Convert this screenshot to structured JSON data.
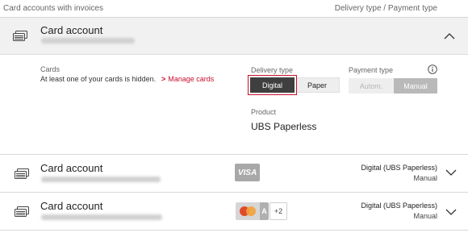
{
  "header": {
    "left": "Card accounts with invoices",
    "right": "Delivery type / Payment type"
  },
  "expanded_account": {
    "title": "Card account",
    "icon": "card-stack-icon",
    "chevron": "chevron-up-icon"
  },
  "details": {
    "cards_label": "Cards",
    "cards_text": "At least one of your cards is hidden.",
    "manage_link": "Manage cards",
    "delivery_label": "Delivery type",
    "delivery_options": [
      "Digital",
      "Paper"
    ],
    "delivery_selected": "Digital",
    "payment_label": "Payment type",
    "payment_options": [
      "Autom.",
      "Manual"
    ],
    "payment_selected": "Manual",
    "info_icon": "info-circle-icon",
    "product_label": "Product",
    "product_value": "UBS Paperless"
  },
  "accounts": [
    {
      "title": "Card account",
      "card_brands": [
        "VISA"
      ],
      "delivery": "Digital (UBS Paperless)",
      "payment": "Manual"
    },
    {
      "title": "Card account",
      "card_brands": [
        "Mastercard",
        "A"
      ],
      "more_count": "+2",
      "delivery": "Digital (UBS Paperless)",
      "payment": "Manual"
    }
  ],
  "colors": {
    "accent": "#c8102e",
    "selected_dark": "#3f3f3f",
    "selected_grey": "#b9b9b9"
  }
}
